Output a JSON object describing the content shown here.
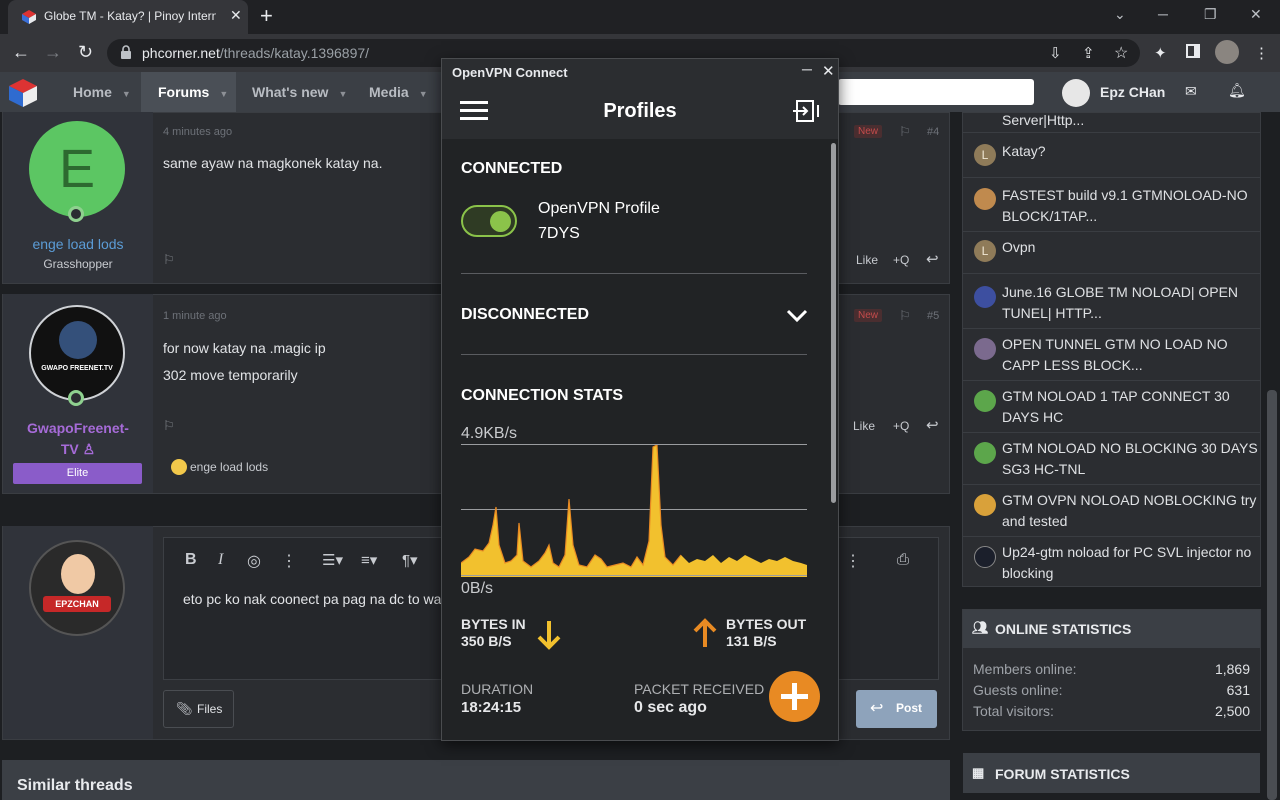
{
  "browser": {
    "tab_title": "Globe TM - Katay? | Pinoy Interne",
    "url_host": "phcorner.net",
    "url_path": "/threads/katay.1396897/"
  },
  "site": {
    "nav": [
      "Home",
      "Forums",
      "What's new",
      "Media"
    ],
    "username": "Epz CHan"
  },
  "posts": [
    {
      "time": "4 minutes ago",
      "badge": "New",
      "number": "#4",
      "avatar_letter": "E",
      "user": "enge load lods",
      "rank": "Grasshopper",
      "text": "same ayaw na magkonek katay na.",
      "like": "Like",
      "quote": "+Q"
    },
    {
      "time": "1 minute ago",
      "badge": "New",
      "number": "#5",
      "avatar_caption": "GWAPO FREENET.TV",
      "user_line1": "GwapoFreenet-",
      "user_line2": "TV",
      "rank": "Elite",
      "text_line1": "for now katay na .magic ip",
      "text_line2": "302 move temporarily",
      "like": "Like",
      "quote": "+Q",
      "reaction_user": "enge load lods"
    }
  ],
  "reply": {
    "avatar_caption": "EPZCHAN",
    "text": "eto pc ko nak coonect pa pag na dc to wa",
    "files": "Files",
    "post": "Post"
  },
  "similar": "Similar threads",
  "sidebar": {
    "threads": [
      {
        "title_line1": "Server|Http..."
      },
      {
        "title_line1": "Katay?",
        "avatar": "L"
      },
      {
        "title_line1": "FASTEST build v9.1 GTMNOLOAD-NO",
        "title_line2": "BLOCK/1TAP..."
      },
      {
        "title_line1": "Ovpn",
        "avatar": "L"
      },
      {
        "title_line1": "June.16 GLOBE TM NOLOAD| OPEN",
        "title_line2": "TUNEL| HTTP..."
      },
      {
        "title_line1": "OPEN TUNNEL GTM NO LOAD NO",
        "title_line2": "CAPP LESS BLOCK..."
      },
      {
        "title_line1": "GTM NOLOAD 1 TAP CONNECT 30",
        "title_line2": "DAYS HC"
      },
      {
        "title_line1": "GTM NOLOAD NO BLOCKING 30 DAYS",
        "title_line2": "SG3 HC-TNL"
      },
      {
        "title_line1": "GTM OVPN NOLOAD NOBLOCKING try",
        "title_line2": "and tested"
      },
      {
        "title_line1": "Up24-gtm noload for PC SVL injector no",
        "title_line2": "blocking"
      }
    ],
    "online_title": "ONLINE STATISTICS",
    "online": [
      {
        "label": "Members online:",
        "value": "1,869"
      },
      {
        "label": "Guests online:",
        "value": "631"
      },
      {
        "label": "Total visitors:",
        "value": "2,500"
      }
    ],
    "forum_title": "FORUM STATISTICS"
  },
  "vpn": {
    "window_title": "OpenVPN Connect",
    "header": "Profiles",
    "connected": "CONNECTED",
    "profile_name": "OpenVPN Profile",
    "profile_sub": "7DYS",
    "toggle_on": true,
    "disconnected": "DISCONNECTED",
    "stats_title": "CONNECTION STATS",
    "top_rate": "4.9KB/s",
    "bottom_rate": "0B/s",
    "bytes_in_label": "BYTES IN",
    "bytes_in": "350 B/S",
    "bytes_out_label": "BYTES OUT",
    "bytes_out": "131 B/S",
    "duration_label": "DURATION",
    "duration": "18:24:15",
    "packet_label": "PACKET RECEIVED",
    "packet": "0 sec ago",
    "accent": "#e88a23",
    "chart_color": "#f2c12e",
    "toggle_color": "#8bc34a"
  }
}
